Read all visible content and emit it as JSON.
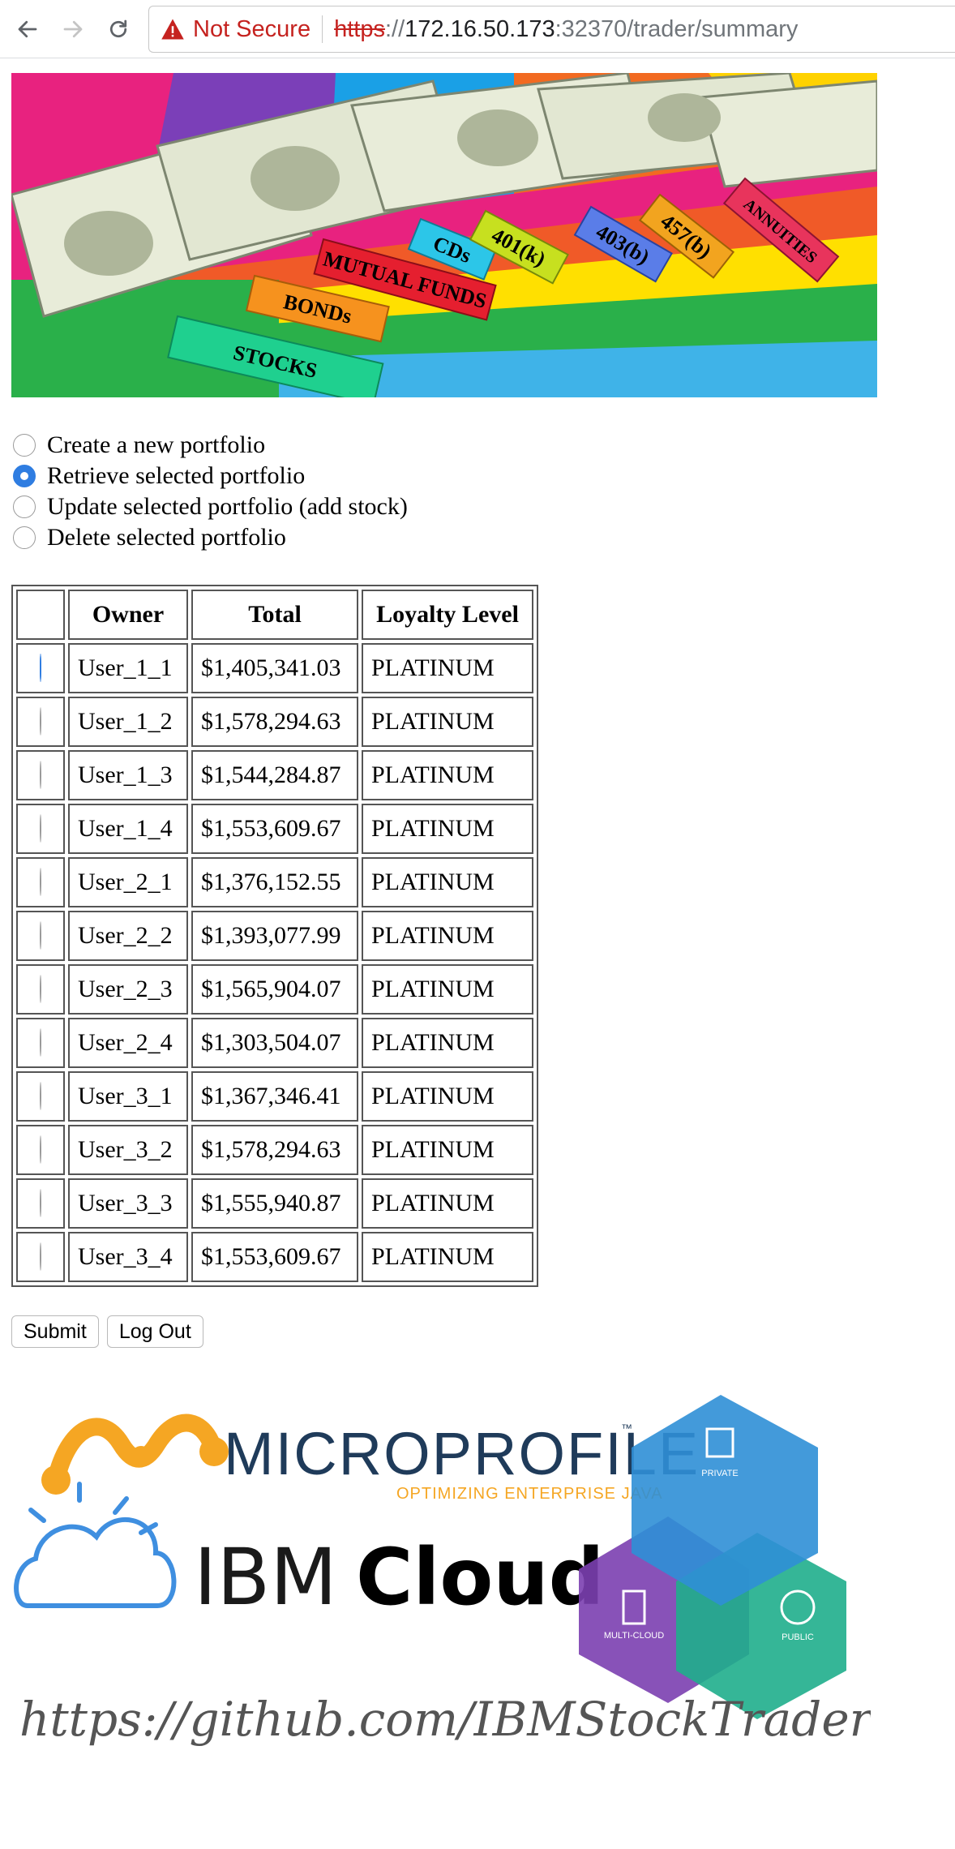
{
  "browser": {
    "security_label": "Not Secure",
    "url_scheme": "https",
    "url_separator": "://",
    "url_host": "172.16.50.173",
    "url_rest": ":32370/trader/summary"
  },
  "banner": {
    "tabs": [
      "STOCKS",
      "BONDs",
      "MUTUAL FUNDS",
      "CDs",
      "401(k)",
      "403(b)",
      "457(b)",
      "ANNUITIES"
    ]
  },
  "actions": [
    {
      "label": "Create a new portfolio",
      "checked": false
    },
    {
      "label": "Retrieve selected portfolio",
      "checked": true
    },
    {
      "label": "Update selected portfolio (add stock)",
      "checked": false
    },
    {
      "label": "Delete selected portfolio",
      "checked": false
    }
  ],
  "table": {
    "headers": {
      "select": "",
      "owner": "Owner",
      "total": "Total",
      "loyalty": "Loyalty Level"
    },
    "rows": [
      {
        "owner": "User_1_1",
        "total": "$1,405,341.03",
        "loyalty": "PLATINUM",
        "selected": true
      },
      {
        "owner": "User_1_2",
        "total": "$1,578,294.63",
        "loyalty": "PLATINUM",
        "selected": false
      },
      {
        "owner": "User_1_3",
        "total": "$1,544,284.87",
        "loyalty": "PLATINUM",
        "selected": false
      },
      {
        "owner": "User_1_4",
        "total": "$1,553,609.67",
        "loyalty": "PLATINUM",
        "selected": false
      },
      {
        "owner": "User_2_1",
        "total": "$1,376,152.55",
        "loyalty": "PLATINUM",
        "selected": false
      },
      {
        "owner": "User_2_2",
        "total": "$1,393,077.99",
        "loyalty": "PLATINUM",
        "selected": false
      },
      {
        "owner": "User_2_3",
        "total": "$1,565,904.07",
        "loyalty": "PLATINUM",
        "selected": false
      },
      {
        "owner": "User_2_4",
        "total": "$1,303,504.07",
        "loyalty": "PLATINUM",
        "selected": false
      },
      {
        "owner": "User_3_1",
        "total": "$1,367,346.41",
        "loyalty": "PLATINUM",
        "selected": false
      },
      {
        "owner": "User_3_2",
        "total": "$1,578,294.63",
        "loyalty": "PLATINUM",
        "selected": false
      },
      {
        "owner": "User_3_3",
        "total": "$1,555,940.87",
        "loyalty": "PLATINUM",
        "selected": false
      },
      {
        "owner": "User_3_4",
        "total": "$1,553,609.67",
        "loyalty": "PLATINUM",
        "selected": false
      }
    ]
  },
  "buttons": {
    "submit": "Submit",
    "logout": "Log Out"
  },
  "footer": {
    "microprofile": "MICROPROFILE",
    "microprofile_tm": "™",
    "microprofile_tagline": "OPTIMIZING ENTERPRISE JAVA",
    "ibm": "IBM",
    "cloud": "Cloud",
    "cube_private": "PRIVATE",
    "cube_multicloud": "MULTI-CLOUD",
    "cube_public": "PUBLIC",
    "github": "https://github.com/IBMStockTrader"
  },
  "colors": {
    "accent": "#2f7de1",
    "warning": "#c5221f",
    "microprofile_orange": "#f5a623",
    "microprofile_navy": "#1f3b5a",
    "ibm_blue": "#1f70c1"
  }
}
